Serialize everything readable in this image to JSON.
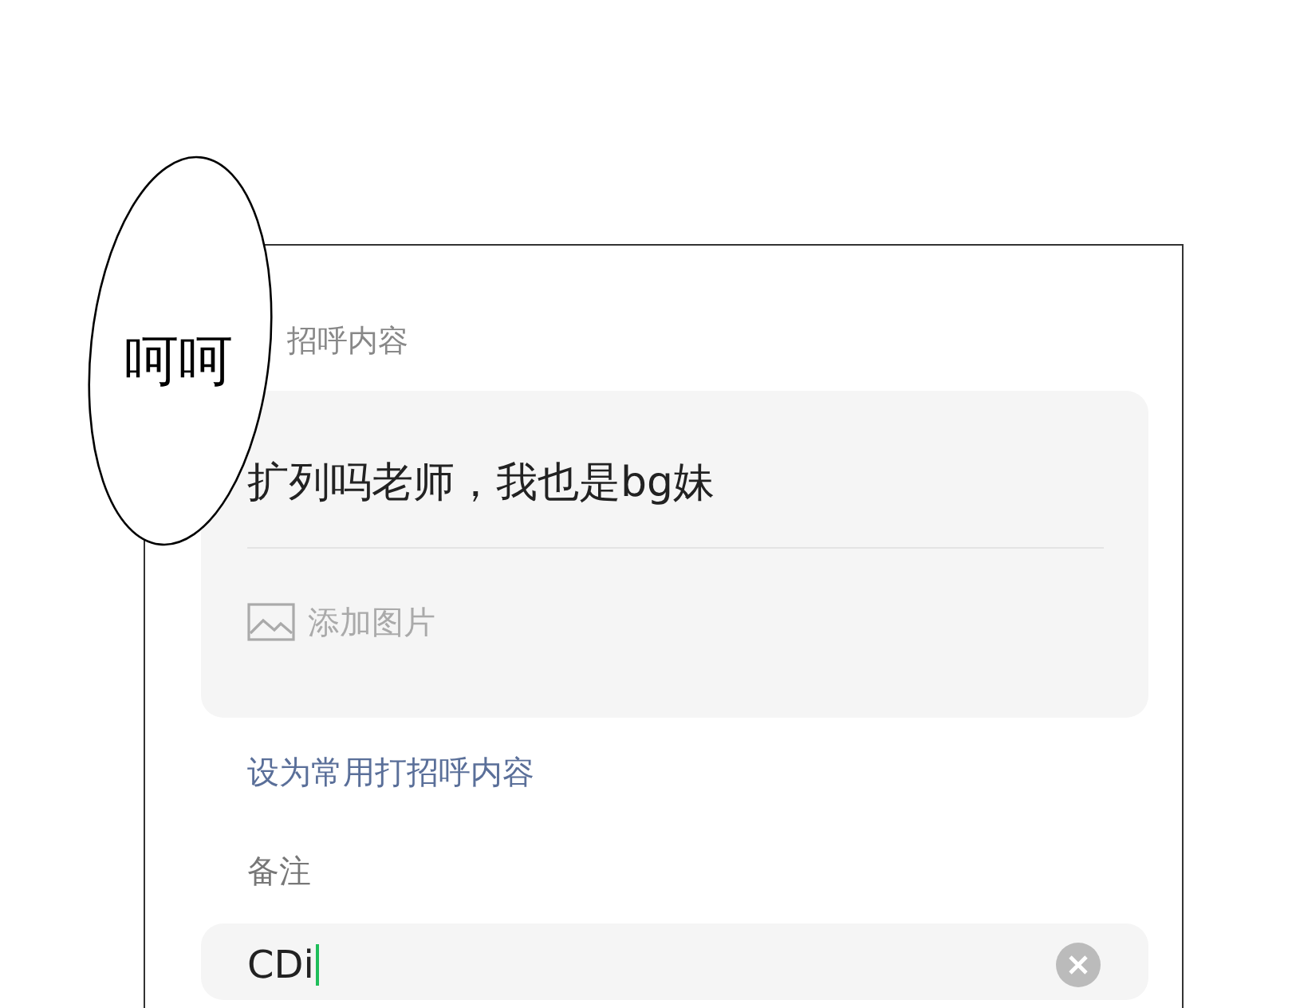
{
  "bubble": {
    "text": "呵呵"
  },
  "greeting": {
    "label": "招呼内容",
    "message": "扩列吗老师，我也是bg妹",
    "add_image": "添加图片"
  },
  "set_default_link": "设为常用打招呼内容",
  "remark": {
    "label": "备注",
    "value": "CDi",
    "focused": true
  }
}
